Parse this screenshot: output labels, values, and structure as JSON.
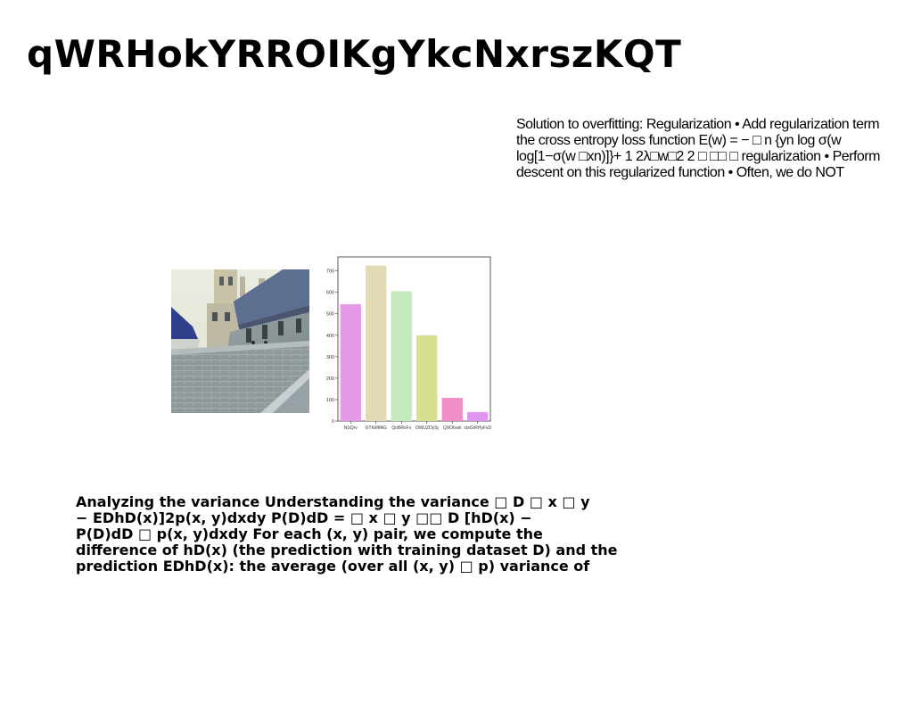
{
  "slide": {
    "title": "qWRHokYRROIKgYkcNxrszKQT"
  },
  "right_text": {
    "lines": [
      "Solution to overfitting: Regularization • Add regularization term",
      "the cross entropy loss function E(w) = − □ n {yn log σ(w",
      "log[1−σ(w □xn)]}+ 1 2λ□w□2 2 □ □□ □ regularization • Perform",
      "descent on this regularized function • Often, we do NOT"
    ]
  },
  "bottom_text": {
    "lines": [
      "Analyzing the variance Understanding the variance □ D □ x □ y",
      "− EDhD(x)]2p(x, y)dxdy P(D)dD = □ x □ y □□ D [hD(x) −",
      "P(D)dD □ p(x, y)dxdy For each (x, y) pair, we compute the",
      "difference of hD(x) (the prediction with training dataset D) and the",
      "prediction EDhD(x): the average (over all (x, y) □ p) variance of"
    ]
  },
  "chart_data": {
    "type": "bar",
    "categories": [
      "NSQrv",
      "GTKiIftfAG",
      "QoBRvFx",
      "OWUZDySj",
      "QXOtvah",
      "ctxGrRHyFsD"
    ],
    "values": [
      545,
      725,
      605,
      400,
      108,
      42
    ],
    "colors": [
      "#e39be8",
      "#e0dbb4",
      "#c4eabe",
      "#d6e08e",
      "#ef8fc5",
      "#df97ef"
    ],
    "yticks": [
      0,
      100,
      200,
      300,
      400,
      500,
      600,
      700
    ],
    "ylim": [
      0,
      765
    ],
    "title": "",
    "xlabel": "",
    "ylabel": ""
  }
}
